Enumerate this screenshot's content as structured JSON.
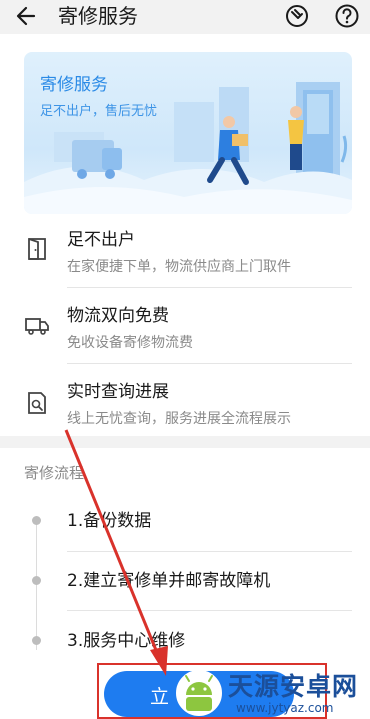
{
  "header": {
    "title": "寄修服务"
  },
  "banner": {
    "title": "寄修服务",
    "subtitle": "足不出户，售后无忧"
  },
  "features": [
    {
      "title": "足不出户",
      "desc": "在家便捷下单，物流供应商上门取件",
      "icon": "door-icon"
    },
    {
      "title": "物流双向免费",
      "desc": "免收设备寄修物流费",
      "icon": "truck-icon"
    },
    {
      "title": "实时查询进展",
      "desc": "线上无忧查询，服务进展全流程展示",
      "icon": "document-search-icon"
    }
  ],
  "process": {
    "title": "寄修流程",
    "steps": [
      "1.备份数据",
      "2.建立寄修单并邮寄故障机",
      "3.服务中心维修"
    ]
  },
  "cta": {
    "label": "立"
  },
  "watermark": {
    "name": "天源安卓网",
    "url": "www.jytyaz.com"
  },
  "colors": {
    "accent": "#1e7cf0",
    "annotation": "#d9322b",
    "banner_text": "#2a8ae6"
  }
}
